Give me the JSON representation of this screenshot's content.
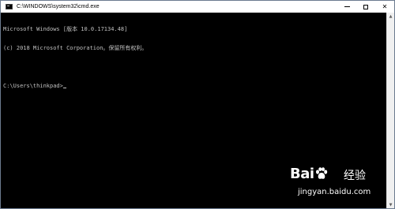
{
  "window": {
    "title": "C:\\WINDOWS\\system32\\cmd.exe",
    "icon": "cmd-console-icon",
    "controls": {
      "minimize": "minimize-icon",
      "maximize": "maximize-icon",
      "close_label": "✕"
    }
  },
  "console": {
    "lines": [
      "Microsoft Windows [版本 10.0.17134.48]",
      "(c) 2018 Microsoft Corporation。保留所有权利。",
      "",
      "C:\\Users\\thinkpad>"
    ]
  },
  "scrollbar": {
    "up_arrow": "▲",
    "down_arrow": "▼"
  },
  "watermark": {
    "logo_left": "Bai",
    "logo_right": "百",
    "logo_suffix": "经验",
    "url": "jingyan.baidu.com"
  },
  "colors": {
    "console_bg": "#000000",
    "console_text": "#c0c0c0",
    "titlebar_bg": "#ffffff"
  }
}
